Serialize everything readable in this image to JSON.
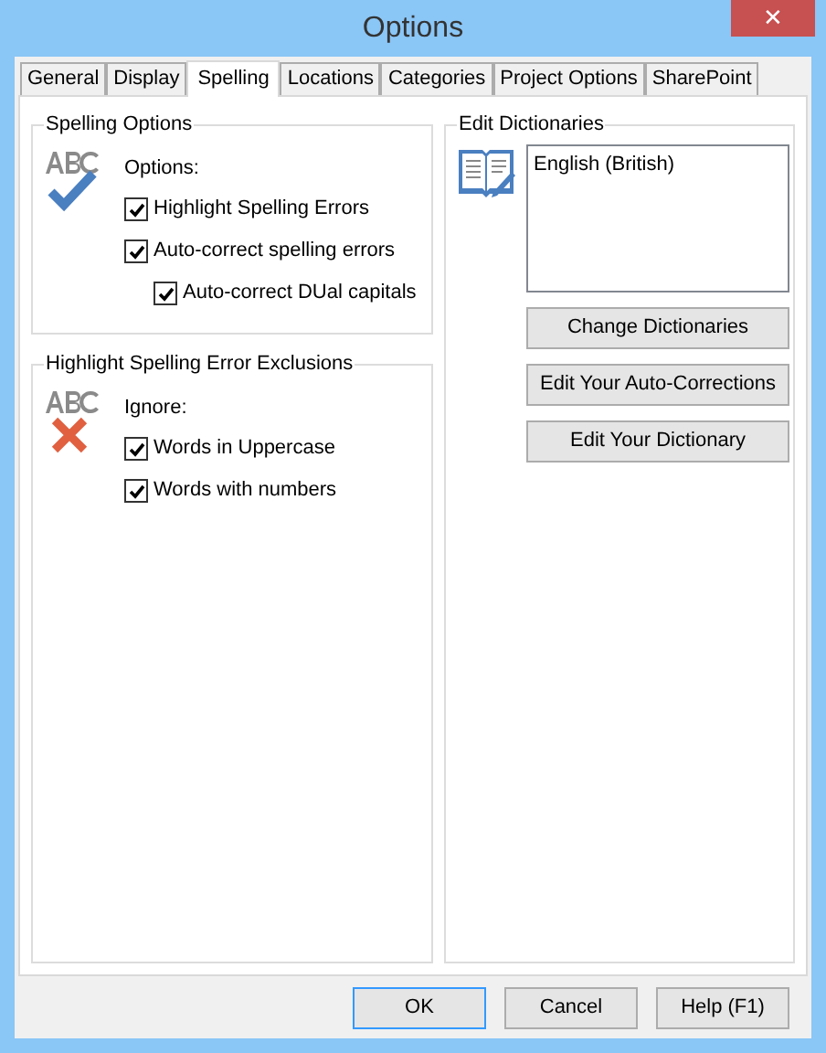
{
  "window": {
    "title": "Options",
    "close": "✕"
  },
  "tabs": [
    {
      "label": "General",
      "selected": false
    },
    {
      "label": "Display",
      "selected": false
    },
    {
      "label": "Spelling",
      "selected": true
    },
    {
      "label": "Locations",
      "selected": false
    },
    {
      "label": "Categories",
      "selected": false
    },
    {
      "label": "Project Options",
      "selected": false
    },
    {
      "label": "SharePoint",
      "selected": false
    }
  ],
  "spelling_options": {
    "title": "Spelling Options",
    "heading": "Options:",
    "items": [
      {
        "label": "Highlight Spelling Errors",
        "checked": true
      },
      {
        "label": "Auto-correct spelling errors",
        "checked": true,
        "children": [
          {
            "label": "Auto-correct DUal capitals",
            "checked": true
          }
        ]
      }
    ]
  },
  "exclusions": {
    "title": "Highlight Spelling Error Exclusions",
    "heading": "Ignore:",
    "items": [
      {
        "label": "Words in Uppercase",
        "checked": true
      },
      {
        "label": "Words with numbers",
        "checked": true
      }
    ]
  },
  "edit_dictionaries": {
    "title": "Edit Dictionaries",
    "dictionaries": [
      {
        "label": "English (British)",
        "selected": false
      }
    ],
    "buttons": [
      "Change Dictionaries",
      "Edit Your Auto-Corrections",
      "Edit Your Dictionary"
    ]
  },
  "footer_buttons": [
    {
      "label": "OK",
      "default": true
    },
    {
      "label": "Cancel",
      "default": false
    },
    {
      "label": "Help (F1)",
      "default": false
    }
  ]
}
